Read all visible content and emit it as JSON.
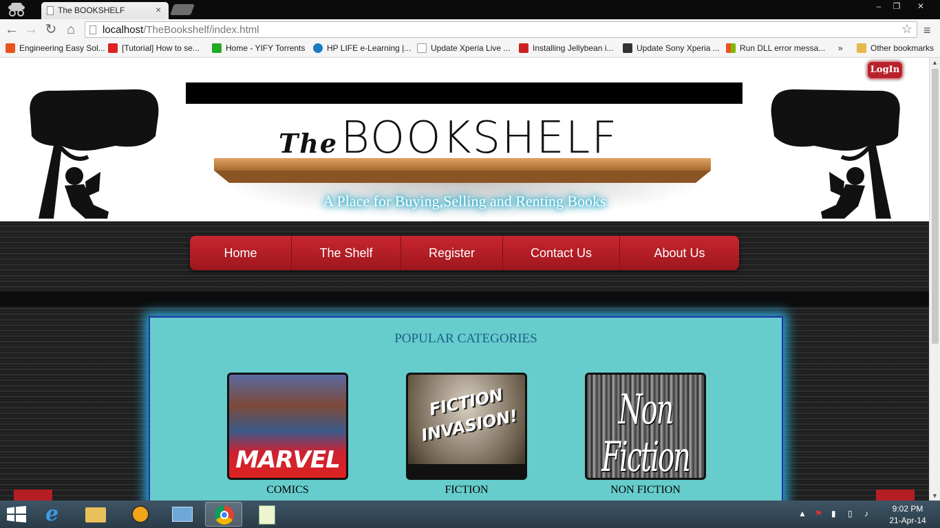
{
  "browser": {
    "tab_title": "The BOOKSHELF",
    "tab_close": "×",
    "url_host": "localhost",
    "url_path": "/TheBookshelf/index.html",
    "window_buttons": [
      "–",
      "❐",
      "✕"
    ],
    "bookmarks": [
      {
        "label": "Engineering Easy Sol...",
        "color": "#e8541c"
      },
      {
        "label": "[Tutorial] How to se...",
        "color": "#d22"
      },
      {
        "label": "Home - YIFY Torrents",
        "color": "#2a2"
      },
      {
        "label": "HP LIFE e-Learning |...",
        "color": "#1a7bc2"
      },
      {
        "label": "Update Xperia Live ...",
        "color": "#bbb"
      },
      {
        "label": "Installing Jellybean i...",
        "color": "#c22"
      },
      {
        "label": "Update Sony Xperia ...",
        "color": "#333"
      },
      {
        "label": "Run DLL error messa...",
        "color": "#f4a400"
      }
    ],
    "bookmarks_overflow": "»",
    "other_bookmarks": "Other bookmarks"
  },
  "page": {
    "login_label": "LogIn",
    "logo_the": "The",
    "logo_main": "BOOKSHELF",
    "tagline": "A Place for Buying,Selling and Renting Books",
    "nav": [
      "Home",
      "The Shelf",
      "Register",
      "Contact Us",
      "About Us"
    ],
    "section_title": "POPULAR CATEGORIES",
    "categories": [
      {
        "caption": "COMICS",
        "image_text": "MARVEL"
      },
      {
        "caption": "FICTION",
        "image_text_1": "FICTION",
        "image_text_2": "INVASION!"
      },
      {
        "caption": "NON FICTION",
        "image_text": "Non Fiction"
      }
    ]
  },
  "taskbar": {
    "time": "9:02 PM",
    "date": "21-Apr-14"
  }
}
